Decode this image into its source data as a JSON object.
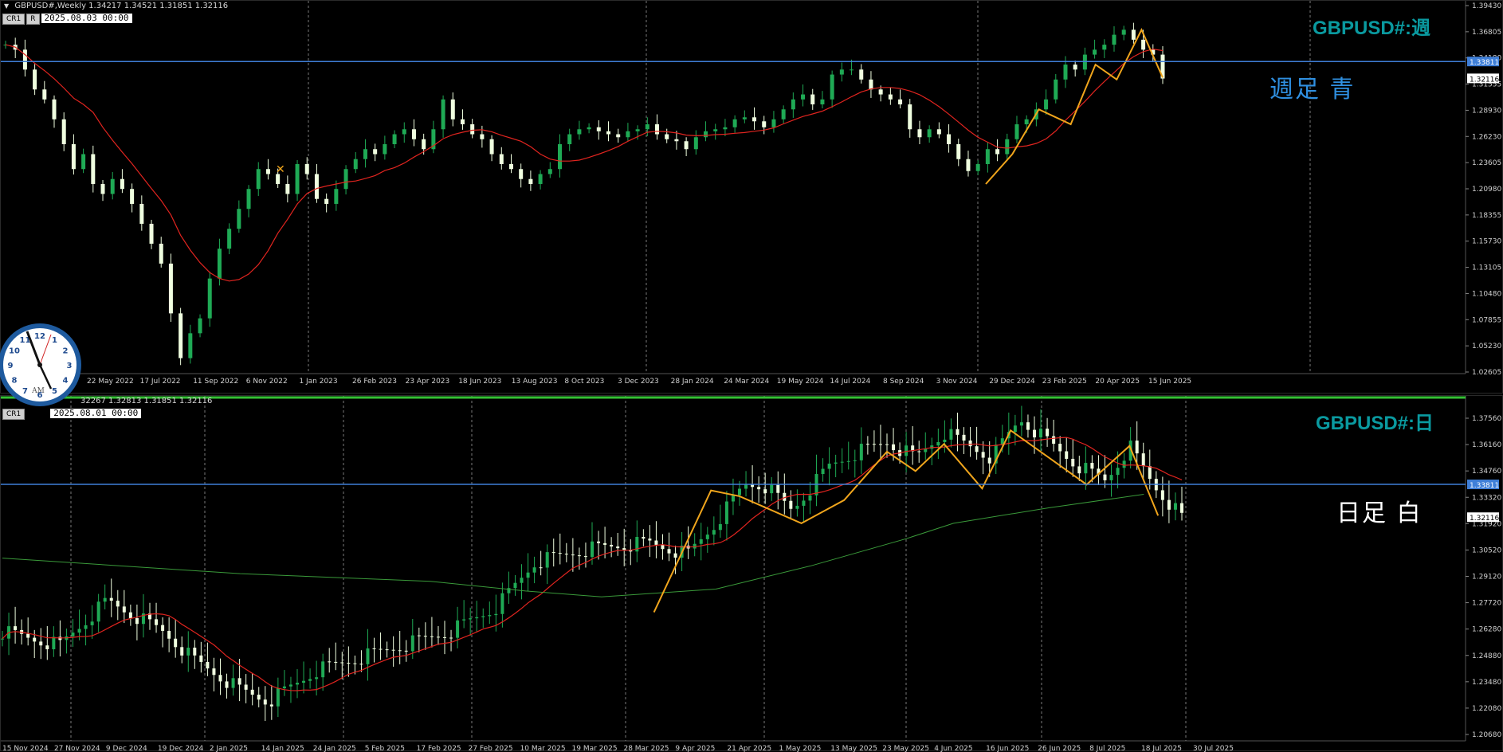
{
  "colors": {
    "bg": "#000000",
    "bull": "#1faa55",
    "bear": "#f0ffe0",
    "ma_fast": "#e0241f",
    "ma_slow": "#3a9a3a",
    "zigzag": "#f0a51c",
    "hline": "#3f7fd8",
    "grid": "#7a7a7a",
    "axis_text": "#d0d0d0",
    "title": "#0a9aa0",
    "note_weekly": "#2f8fe0",
    "note_daily": "#ffffff",
    "price_tag": "#3f7fd8",
    "current_tag": "#ffffff"
  },
  "weekly": {
    "header": "GBPUSD#,Weekly  1.34217 1.34521 1.31851 1.32116",
    "btn_cr1": "CR1",
    "btn_r": "R",
    "datetime": "2025.08.03 00:00",
    "title": "GBPUSD#:週",
    "note": "週足  青",
    "price_labels": [
      "1.39430",
      "1.36805",
      "1.34180",
      "1.31555",
      "1.28930",
      "1.26230",
      "1.23605",
      "1.20980",
      "1.18355",
      "1.15730",
      "1.13105",
      "1.10480",
      "1.07855",
      "1.05230",
      "1.02605"
    ],
    "price_range": [
      1.02605,
      1.3943
    ],
    "hline_tag": "1.33811",
    "current_tag": "1.32116",
    "hline_price": 1.33811,
    "current_price": 1.32116,
    "date_labels": [
      "22 May 2022",
      "17 Jul 2022",
      "11 Sep 2022",
      "6 Nov 2022",
      "1 Jan 2023",
      "26 Feb 2023",
      "23 Apr 2023",
      "18 Jun 2023",
      "13 Aug 2023",
      "8 Oct 2023",
      "3 Dec 2023",
      "28 Jan 2024",
      "24 Mar 2024",
      "19 May 2024",
      "14 Jul 2024",
      "8 Sep 2024",
      "3 Nov 2024",
      "29 Dec 2024",
      "23 Feb 2025",
      "20 Apr 2025",
      "15 Jun 2025"
    ],
    "key_closes": [
      1.355,
      1.35,
      1.33,
      1.31,
      1.3,
      1.28,
      1.255,
      1.23,
      1.245,
      1.215,
      1.205,
      1.22,
      1.21,
      1.195,
      1.175,
      1.155,
      1.135,
      1.085,
      1.04,
      1.065,
      1.08,
      1.12,
      1.15,
      1.17,
      1.19,
      1.21,
      1.23,
      1.225,
      1.215,
      1.205,
      1.235,
      1.225,
      1.2,
      1.195,
      1.21,
      1.23,
      1.24,
      1.25,
      1.245,
      1.255,
      1.265,
      1.27,
      1.26,
      1.25,
      1.27,
      1.3,
      1.28,
      1.275,
      1.265,
      1.26,
      1.245,
      1.235,
      1.23,
      1.22,
      1.215,
      1.225,
      1.23,
      1.255,
      1.265,
      1.27,
      1.272,
      1.268,
      1.265,
      1.262,
      1.268,
      1.27,
      1.275,
      1.265,
      1.26,
      1.258,
      1.25,
      1.262,
      1.268,
      1.27,
      1.272,
      1.28,
      1.282,
      1.278,
      1.272,
      1.28,
      1.29,
      1.3,
      1.305,
      1.295,
      1.3,
      1.325,
      1.33,
      1.33,
      1.32,
      1.31,
      1.305,
      1.3,
      1.295,
      1.27,
      1.262,
      1.27,
      1.265,
      1.255,
      1.24,
      1.228,
      1.235,
      1.25,
      1.245,
      1.26,
      1.275,
      1.28,
      1.29,
      1.3,
      1.32,
      1.335,
      1.33,
      1.345,
      1.35,
      1.355,
      1.365,
      1.37,
      1.36,
      1.35,
      1.345,
      1.321
    ],
    "zigzag": [
      [
        0.0,
        1.215
      ],
      [
        0.15,
        1.245
      ],
      [
        0.3,
        1.29
      ],
      [
        0.48,
        1.275
      ],
      [
        0.62,
        1.335
      ],
      [
        0.74,
        1.32
      ],
      [
        0.88,
        1.37
      ],
      [
        1.0,
        1.322
      ]
    ]
  },
  "daily": {
    "header": "32267 1.32813 1.31851 1.32116",
    "btn_cr1": "CR1",
    "datetime": "2025.08.01 00:00",
    "title": "GBPUSD#:日",
    "note": "日足   白",
    "price_labels": [
      "1.37560",
      "1.36160",
      "1.34760",
      "1.33320",
      "1.31920",
      "1.30520",
      "1.29120",
      "1.27720",
      "1.26280",
      "1.24880",
      "1.23480",
      "1.22080",
      "1.20680"
    ],
    "price_range": [
      1.2068,
      1.3756
    ],
    "hline_tag": "1.33811",
    "current_tag": "1.32116",
    "date_labels": [
      "15 Nov 2024",
      "27 Nov 2024",
      "9 Dec 2024",
      "19 Dec 2024",
      "2 Jan 2025",
      "14 Jan 2025",
      "24 Jan 2025",
      "5 Feb 2025",
      "17 Feb 2025",
      "27 Feb 2025",
      "10 Mar 2025",
      "19 Mar 2025",
      "28 Mar 2025",
      "9 Apr 2025",
      "21 Apr 2025",
      "1 May 2025",
      "13 May 2025",
      "23 May 2025",
      "4 Jun 2025",
      "16 Jun 2025",
      "26 Jun 2025",
      "8 Jul 2025",
      "18 Jul 2025",
      "30 Jul 2025"
    ]
  },
  "clock": {
    "label": "AM",
    "numerals": [
      "12",
      "1",
      "2",
      "3",
      "4",
      "5",
      "6",
      "7",
      "8",
      "9",
      "10",
      "11"
    ]
  }
}
